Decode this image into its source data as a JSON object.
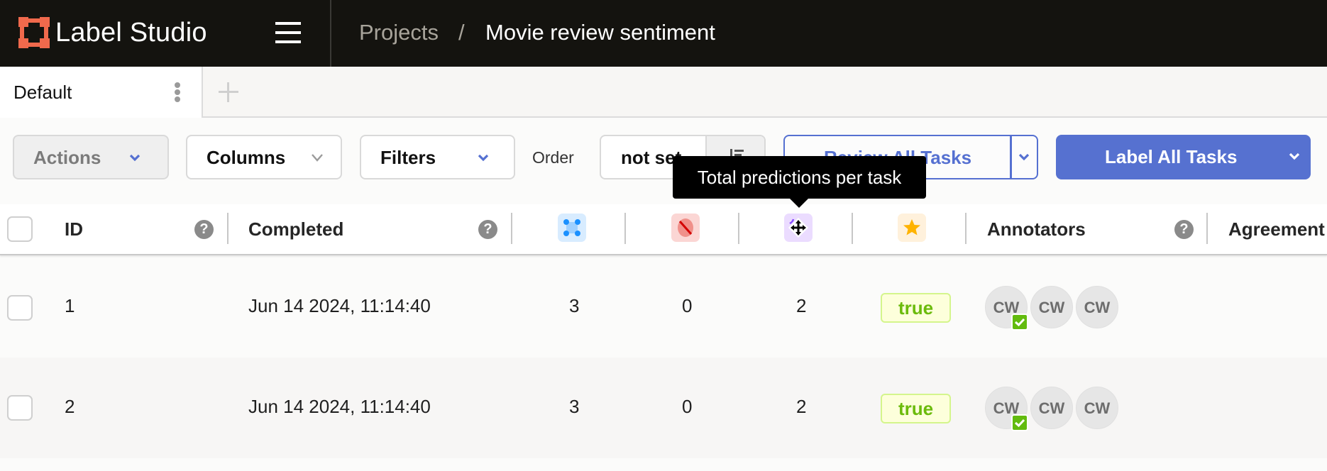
{
  "header": {
    "app_name": "Label Studio",
    "breadcrumb": {
      "root": "Projects",
      "separator": "/",
      "current": "Movie review sentiment"
    },
    "colors": {
      "background": "#14130f",
      "logo": "#f0694c"
    }
  },
  "tabs": {
    "items": [
      {
        "label": "Default",
        "active": true
      }
    ],
    "add_label": "+"
  },
  "toolbar": {
    "actions_label": "Actions",
    "columns_label": "Columns",
    "filters_label": "Filters",
    "order_label": "Order",
    "order_value": "not set",
    "review_label": "Review All Tasks",
    "label_all_label": "Label All Tasks",
    "accent_color": "#5671d0"
  },
  "tooltip": {
    "text": "Total predictions per task"
  },
  "table": {
    "columns": [
      {
        "key": "id",
        "label": "ID",
        "help": true
      },
      {
        "key": "completed",
        "label": "Completed",
        "help": true
      },
      {
        "key": "total_annotations",
        "icon": "annotations-icon",
        "color": "#d8ecff"
      },
      {
        "key": "cancelled",
        "icon": "cancelled-icon",
        "color": "#fbd6d4"
      },
      {
        "key": "predictions",
        "icon": "predictions-icon",
        "color": "#ebdcff"
      },
      {
        "key": "reviewed",
        "icon": "star-icon",
        "color": "#fff1dc"
      },
      {
        "key": "annotators",
        "label": "Annotators",
        "help": true
      },
      {
        "key": "agreement",
        "label": "Agreement"
      }
    ],
    "help_glyph": "?",
    "rows": [
      {
        "id": "1",
        "completed": "Jun 14 2024, 11:14:40",
        "total_annotations": "3",
        "cancelled": "0",
        "predictions": "2",
        "reviewed": "true",
        "annotators": [
          "CW",
          "CW",
          "CW"
        ]
      },
      {
        "id": "2",
        "completed": "Jun 14 2024, 11:14:40",
        "total_annotations": "3",
        "cancelled": "0",
        "predictions": "2",
        "reviewed": "true",
        "annotators": [
          "CW",
          "CW",
          "CW"
        ]
      }
    ]
  }
}
